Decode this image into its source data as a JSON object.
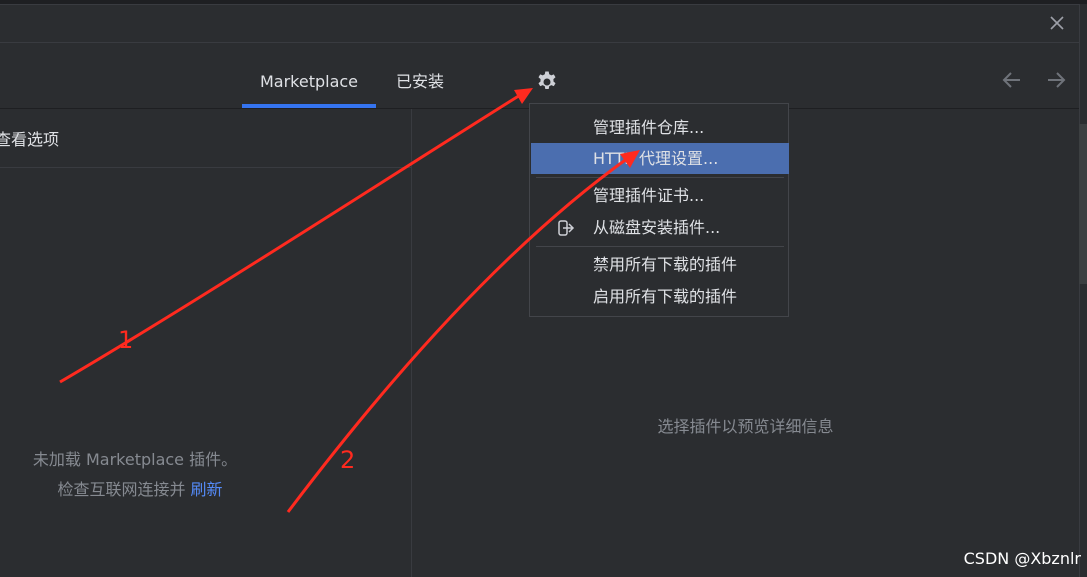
{
  "tabs": {
    "marketplace": "Marketplace",
    "installed": "已安装"
  },
  "left_panel": {
    "header_text": "查看选项",
    "empty_line1": "未加载 Marketplace 插件。",
    "empty_line2_prefix": "检查互联网连接并 ",
    "refresh_link": "刷新"
  },
  "right_panel": {
    "placeholder": "选择插件以预览详细信息"
  },
  "settings_menu": {
    "items": [
      {
        "label": "管理插件仓库..."
      },
      {
        "label": "HTTP 代理设置...",
        "selected": true
      },
      {
        "label": "管理插件证书..."
      },
      {
        "label": "从磁盘安装插件..."
      },
      {
        "label": "禁用所有下载的插件"
      },
      {
        "label": "启用所有下载的插件"
      }
    ]
  },
  "annotations": {
    "label1": "1",
    "label2": "2",
    "color": "#ff2a1f"
  },
  "watermark": "CSDN @Xbznlr",
  "icons": {
    "close": "close-icon",
    "gear": "gear-icon",
    "back": "arrow-left-icon",
    "forward": "arrow-right-icon",
    "disk": "install-from-disk-icon"
  },
  "colors": {
    "background": "#2b2d30",
    "accent": "#3574f0",
    "menu_selected": "#4b6eaf",
    "link": "#548af7",
    "muted_text": "#868a91"
  }
}
